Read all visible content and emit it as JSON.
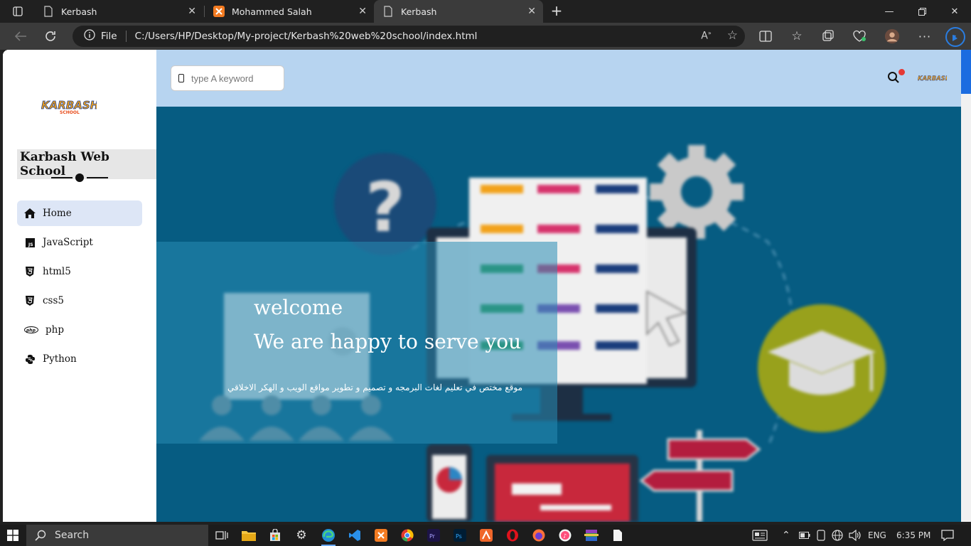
{
  "browser": {
    "tabs": [
      {
        "title": "Kerbash",
        "icon": "page-icon"
      },
      {
        "title": "Mohammed Salah",
        "icon": "xampp-icon"
      },
      {
        "title": "Kerbash",
        "icon": "page-icon"
      }
    ],
    "address": {
      "scheme_label": "File",
      "url": "C:/Users/HP/Desktop/My-project/Kerbash%20web%20school/index.html"
    }
  },
  "page": {
    "logo_text": "KARBASH",
    "logo_sub": "SCHOOL",
    "site_title": "Karbash Web School",
    "menu": [
      {
        "label": "Home",
        "icon": "home-icon"
      },
      {
        "label": "JavaScript",
        "icon": "js-icon"
      },
      {
        "label": "html5",
        "icon": "html5-icon"
      },
      {
        "label": "css5",
        "icon": "css-icon"
      },
      {
        "label": "php",
        "icon": "php-icon"
      },
      {
        "label": "Python",
        "icon": "python-icon"
      }
    ],
    "search_placeholder": "type A keyword",
    "hero": {
      "welcome": "welcome",
      "tagline": "We are happy to serve you",
      "description_ar": "موقع مختص في تعليم لغات البرمجه و تصميم و تطوير مواقع الويب و الهكر الاخلاقي"
    }
  },
  "taskbar": {
    "search_label": "Search",
    "language": "ENG",
    "time": "6:35 PM"
  },
  "colors": {
    "header_bg": "#b7d4f0",
    "hero_bg": "#065c82",
    "active_menu_bg": "#dde6f6",
    "notification": "#e53935"
  }
}
